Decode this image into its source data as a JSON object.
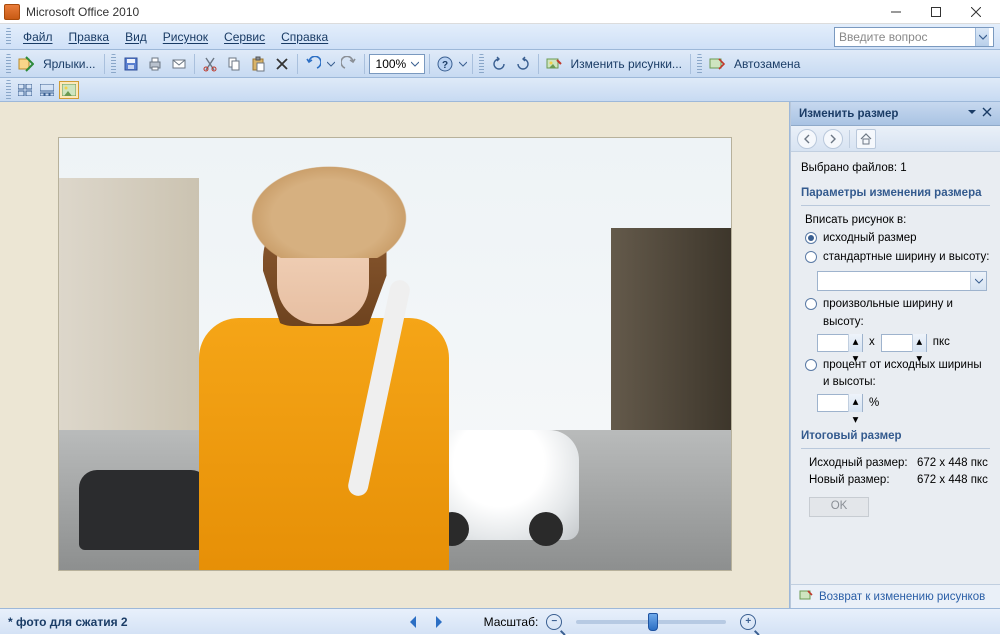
{
  "app": {
    "title": "Microsoft Office 2010"
  },
  "menu": {
    "file": "Файл",
    "edit": "Правка",
    "view": "Вид",
    "picture": "Рисунок",
    "tools": "Сервис",
    "help": "Справка",
    "search_placeholder": "Введите вопрос"
  },
  "toolbar": {
    "shortcuts": "Ярлыки...",
    "zoom_value": "100%",
    "edit_pictures": "Изменить рисунки...",
    "autocorrect": "Автозамена"
  },
  "panel": {
    "title": "Изменить размер",
    "selected_files_label": "Выбрано файлов:",
    "selected_files_count": "1",
    "params_header": "Параметры изменения размера",
    "fit_label": "Вписать рисунок в:",
    "opt_original": "исходный размер",
    "opt_standard": "стандартные ширину и высоту:",
    "opt_custom": "произвольные ширину и высоту:",
    "custom_sep": "x",
    "custom_unit": "пкс",
    "opt_percent": "процент от исходных ширины и высоты:",
    "percent_unit": "%",
    "result_header": "Итоговый размер",
    "orig_size_label": "Исходный размер:",
    "orig_size_value": "672 x 448 пкс",
    "new_size_label": "Новый размер:",
    "new_size_value": "672 x 448 пкс",
    "ok": "OK",
    "footer_link": "Возврат к изменению рисунков"
  },
  "status": {
    "filename": "* фото для сжатия 2",
    "zoom_label": "Масштаб:"
  }
}
